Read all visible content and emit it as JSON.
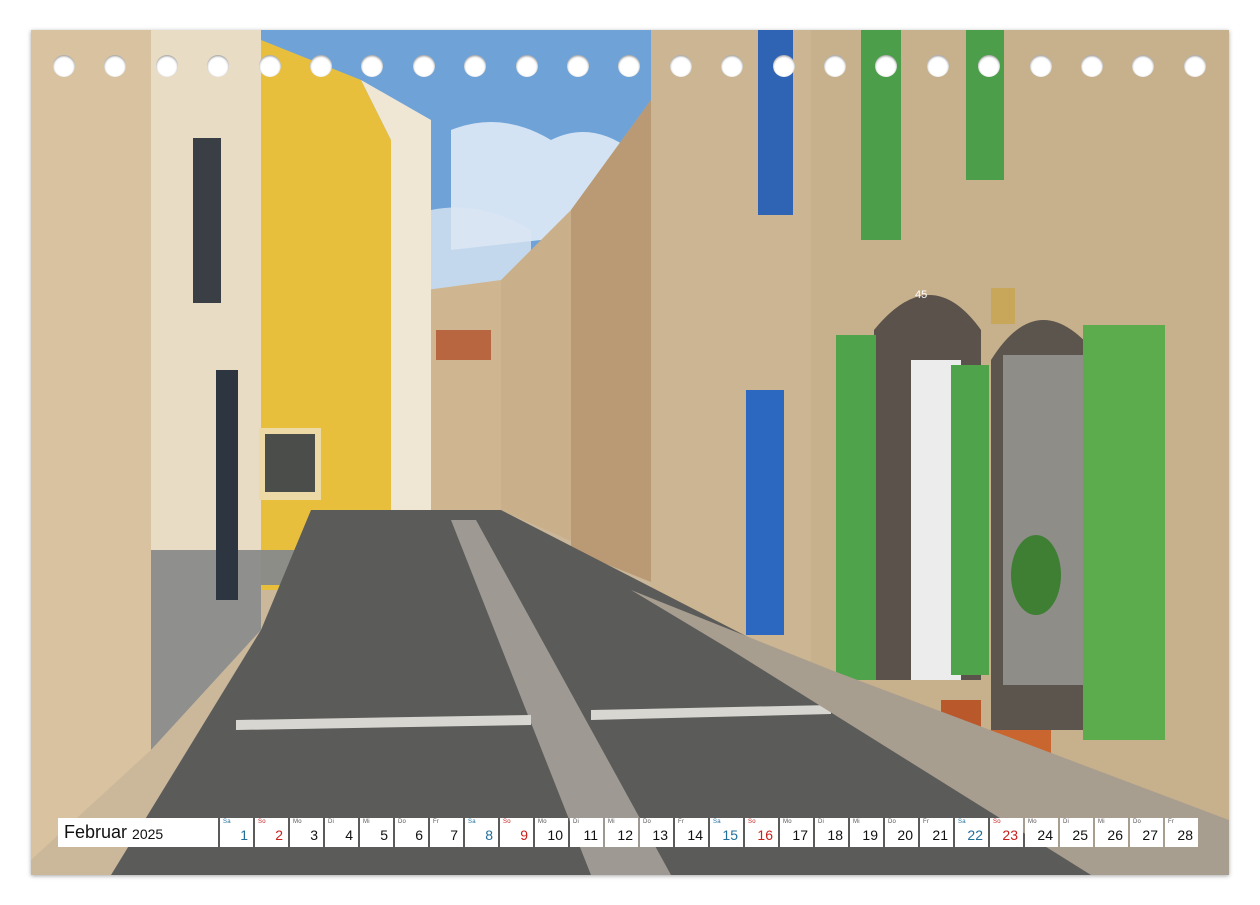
{
  "calendar": {
    "month": "Februar",
    "year": "2025",
    "colors": {
      "saturday": "#1f6f9a",
      "sunday": "#c8201b",
      "weekday": "#111111"
    },
    "days": [
      {
        "dow": "Sa",
        "num": "1",
        "type": "sat"
      },
      {
        "dow": "So",
        "num": "2",
        "type": "sun"
      },
      {
        "dow": "Mo",
        "num": "3",
        "type": "wd"
      },
      {
        "dow": "Di",
        "num": "4",
        "type": "wd"
      },
      {
        "dow": "Mi",
        "num": "5",
        "type": "wd"
      },
      {
        "dow": "Do",
        "num": "6",
        "type": "wd"
      },
      {
        "dow": "Fr",
        "num": "7",
        "type": "wd"
      },
      {
        "dow": "Sa",
        "num": "8",
        "type": "sat"
      },
      {
        "dow": "So",
        "num": "9",
        "type": "sun"
      },
      {
        "dow": "Mo",
        "num": "10",
        "type": "wd"
      },
      {
        "dow": "Di",
        "num": "11",
        "type": "wd"
      },
      {
        "dow": "Mi",
        "num": "12",
        "type": "wd"
      },
      {
        "dow": "Do",
        "num": "13",
        "type": "wd"
      },
      {
        "dow": "Fr",
        "num": "14",
        "type": "wd"
      },
      {
        "dow": "Sa",
        "num": "15",
        "type": "sat"
      },
      {
        "dow": "So",
        "num": "16",
        "type": "sun"
      },
      {
        "dow": "Mo",
        "num": "17",
        "type": "wd"
      },
      {
        "dow": "Di",
        "num": "18",
        "type": "wd"
      },
      {
        "dow": "Mi",
        "num": "19",
        "type": "wd"
      },
      {
        "dow": "Do",
        "num": "20",
        "type": "wd"
      },
      {
        "dow": "Fr",
        "num": "21",
        "type": "wd"
      },
      {
        "dow": "Sa",
        "num": "22",
        "type": "sat"
      },
      {
        "dow": "So",
        "num": "23",
        "type": "sun"
      },
      {
        "dow": "Mo",
        "num": "24",
        "type": "wd"
      },
      {
        "dow": "Di",
        "num": "25",
        "type": "wd"
      },
      {
        "dow": "Mi",
        "num": "26",
        "type": "wd"
      },
      {
        "dow": "Do",
        "num": "27",
        "type": "wd"
      },
      {
        "dow": "Fr",
        "num": "28",
        "type": "wd"
      }
    ]
  },
  "photo": {
    "subject": "street-photo",
    "door_sign": "45"
  }
}
